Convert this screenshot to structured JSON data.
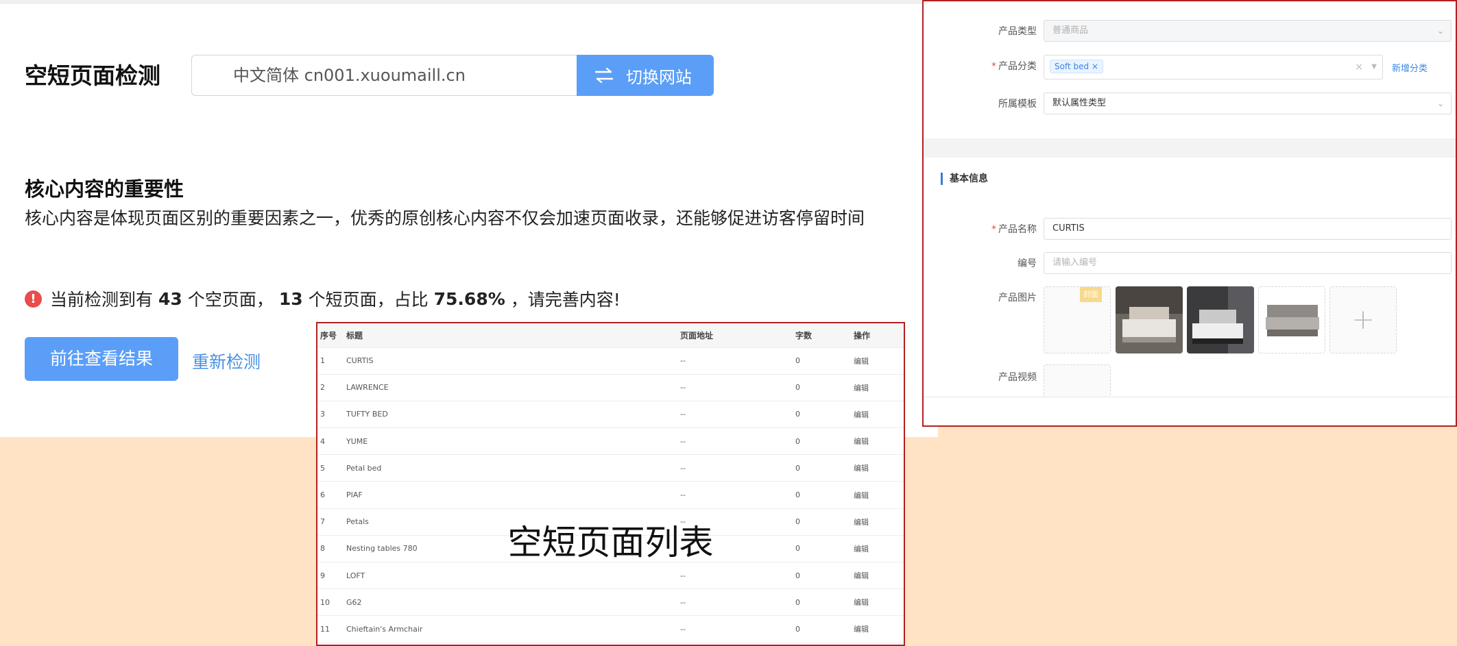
{
  "main": {
    "title": "空短页面检测",
    "site_value": "中文简体 cn001.xuoumaill.cn",
    "switch_label": "切换网站",
    "section_heading": "核心内容的重要性",
    "section_desc": "核心内容是体现页面区别的重要因素之一，优秀的原创核心内容不仅会加速页面收录，还能够促进访客停留时间",
    "result": {
      "prefix": "当前检测到有",
      "empty_count": "43",
      "empty_suffix": "个空页面，",
      "short_count": "13",
      "short_suffix": "个短页面，占比",
      "ratio": "75.68%",
      "ending": "，请完善内容!"
    },
    "view_results_label": "前往查看结果",
    "recheck_label": "重新检测"
  },
  "list": {
    "overlay_label": "空短页面列表",
    "columns": [
      "序号",
      "标题",
      "页面地址",
      "字数",
      "操作"
    ],
    "rows": [
      {
        "no": "1",
        "title": "CURTIS",
        "url": "--",
        "count": "0",
        "action": "编辑"
      },
      {
        "no": "2",
        "title": "LAWRENCE",
        "url": "--",
        "count": "0",
        "action": "编辑"
      },
      {
        "no": "3",
        "title": "TUFTY BED",
        "url": "--",
        "count": "0",
        "action": "编辑"
      },
      {
        "no": "4",
        "title": "YUME",
        "url": "--",
        "count": "0",
        "action": "编辑"
      },
      {
        "no": "5",
        "title": "Petal bed",
        "url": "--",
        "count": "0",
        "action": "编辑"
      },
      {
        "no": "6",
        "title": "PIAF",
        "url": "--",
        "count": "0",
        "action": "编辑"
      },
      {
        "no": "7",
        "title": "Petals",
        "url": "--",
        "count": "0",
        "action": "编辑"
      },
      {
        "no": "8",
        "title": "Nesting tables 780",
        "url": "--",
        "count": "0",
        "action": "编辑"
      },
      {
        "no": "9",
        "title": "LOFT",
        "url": "--",
        "count": "0",
        "action": "编辑"
      },
      {
        "no": "10",
        "title": "G62",
        "url": "--",
        "count": "0",
        "action": "编辑"
      },
      {
        "no": "11",
        "title": "Chieftain's Armchair",
        "url": "--",
        "count": "0",
        "action": "编辑"
      }
    ]
  },
  "form": {
    "product_type_label": "产品类型",
    "product_type_value": "普通商品",
    "category_label": "产品分类",
    "category_tag": "Soft bed",
    "add_category_label": "新增分类",
    "template_label": "所属模板",
    "template_value": "默认属性类型",
    "basic_title": "基本信息",
    "name_label": "产品名称",
    "name_value": "CURTIS",
    "code_label": "编号",
    "code_placeholder": "请输入编号",
    "images_label": "产品图片",
    "cover_badge": "封面",
    "video_label": "产品视频"
  },
  "colors": {
    "accent": "#5b9ef7",
    "link": "#4a90e2",
    "alert": "#e84c4c",
    "frame": "#b32020",
    "background": "#ffe3c4"
  }
}
